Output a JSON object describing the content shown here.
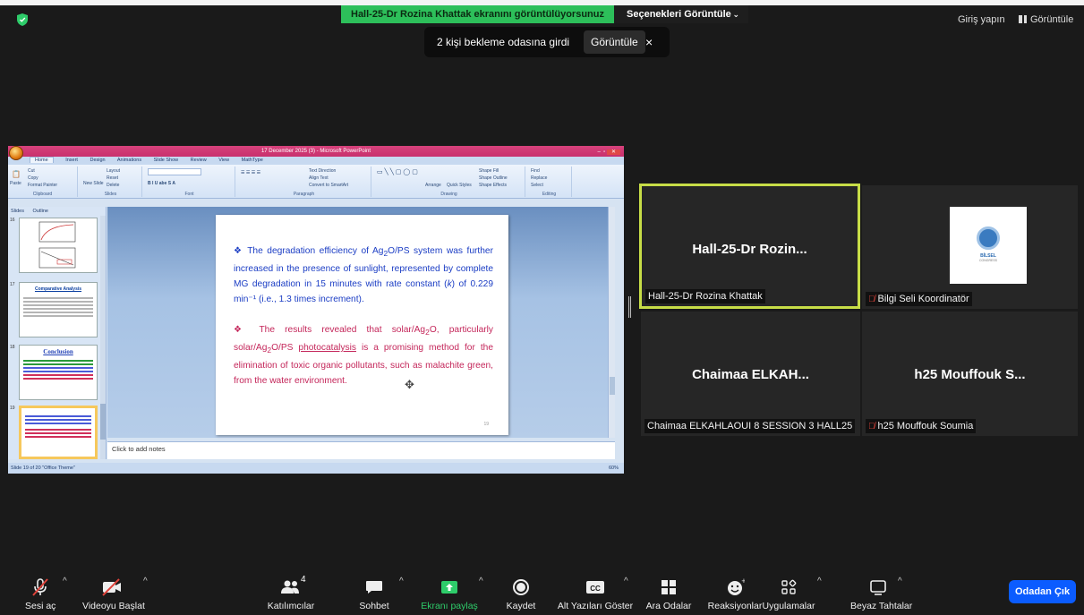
{
  "banner": {
    "sharing_text": "Hall-25-Dr Rozina Khattak ekranını görüntülüyorsunuz",
    "view_options_label": "Seçenekleri Görüntüle",
    "signin_label": "Giriş yapın",
    "view_label": "Görüntüle"
  },
  "waiting_toast": {
    "message": "2 kişi bekleme odasına girdi",
    "view_button": "Görüntüle",
    "close": "×"
  },
  "powerpoint": {
    "window_title": "17 December 2025 (3) - Microsoft PowerPoint",
    "tabs": [
      "Home",
      "Insert",
      "Design",
      "Animations",
      "Slide Show",
      "Review",
      "View",
      "MathType"
    ],
    "ribbon_groups": [
      "Clipboard",
      "Slides",
      "Font",
      "Paragraph",
      "Drawing",
      "Editing"
    ],
    "ribbon_items": {
      "paste": "Paste",
      "cut": "Cut",
      "copy": "Copy",
      "format_painter": "Format Painter",
      "new_slide": "New Slide",
      "layout": "Layout",
      "reset": "Reset",
      "delete": "Delete",
      "text_direction": "Text Direction",
      "align_text": "Align Text",
      "convert_smartart": "Convert to SmartArt",
      "arrange": "Arrange",
      "quick_styles": "Quick Styles",
      "shape_fill": "Shape Fill",
      "shape_outline": "Shape Outline",
      "shape_effects": "Shape Effects",
      "find": "Find",
      "replace": "Replace",
      "select": "Select"
    },
    "pane_tabs": [
      "Slides",
      "Outline"
    ],
    "thumbnails": [
      {
        "num": "16",
        "title": ""
      },
      {
        "num": "17",
        "title": "Comparative Analysis"
      },
      {
        "num": "18",
        "title": "Conclusion"
      },
      {
        "num": "19",
        "title": ""
      }
    ],
    "slide": {
      "para1_lead": "❖ The degradation efficiency of Ag",
      "para1_sub1": "2",
      "para1_rest": "O/PS system was further increased in the presence of sunlight, represented by complete MG degradation in 15 minutes with rate constant (",
      "para1_k": "k",
      "para1_end": ") of 0.229 min⁻¹ (i.e., 1.3 times increment).",
      "para2_lead": "❖ The results revealed that solar/Ag",
      "para2_sub1": "2",
      "para2_mid": "O, particularly solar/Ag",
      "para2_sub2": "2",
      "para2_mid2": "O/PS ",
      "para2_link": "photocatalysis",
      "para2_end": " is a promising method for the elimination of toxic organic pollutants, such as malachite green, from the water environment.",
      "number": "19"
    },
    "notes_placeholder": "Click to add notes",
    "status_text": "Slide 19 of 20   \"Office Theme\"",
    "zoom": "60%"
  },
  "participants": [
    {
      "big_name": "Hall-25-Dr  Rozin...",
      "label": "Hall-25-Dr Rozina Khattak",
      "muted": false,
      "active": true
    },
    {
      "big_name": "",
      "label": "Bilgi Seli Koordinatör",
      "muted": true,
      "active": false,
      "logo_text": "BİLSEL",
      "logo_sub": "CONGRESS"
    },
    {
      "big_name": "Chaimaa  ELKAH...",
      "label": "Chaimaa ELKAHLAOUI 8 SESSION 3 HALL25",
      "muted": false,
      "active": false
    },
    {
      "big_name": "h25  Mouffouk  S...",
      "label": "h25 Mouffouk Soumia",
      "muted": true,
      "active": false
    }
  ],
  "toolbar": {
    "unmute": "Sesi aç",
    "start_video": "Videoyu Başlat",
    "participants": "Katılımcılar",
    "participants_count": "4",
    "chat": "Sohbet",
    "share_screen": "Ekranı paylaş",
    "record": "Kaydet",
    "captions": "Alt Yazıları Göster",
    "breakout": "Ara Odalar",
    "reactions": "Reaksiyonlar",
    "apps": "Uygulamalar",
    "whiteboard": "Beyaz Tahtalar",
    "leave": "Odadan Çık"
  },
  "colors": {
    "share_banner": "#2dbf5a",
    "active_speaker": "#c7dd47",
    "leave_button": "#0b5cff",
    "muted_red": "#e0433b",
    "slide_blue": "#1b3dc4",
    "slide_red": "#c4265a"
  }
}
